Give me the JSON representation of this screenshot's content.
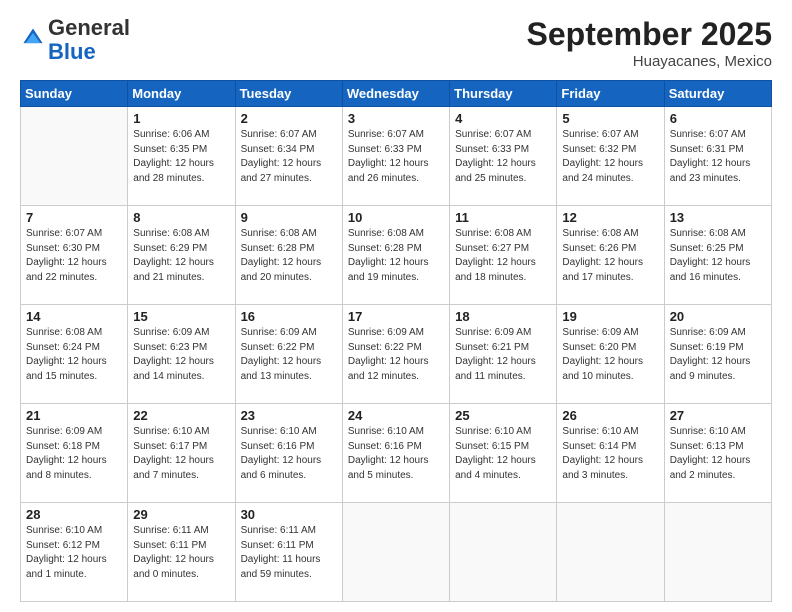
{
  "logo": {
    "line1": "General",
    "line2": "Blue"
  },
  "header": {
    "title": "September 2025",
    "subtitle": "Huayacanes, Mexico"
  },
  "weekdays": [
    "Sunday",
    "Monday",
    "Tuesday",
    "Wednesday",
    "Thursday",
    "Friday",
    "Saturday"
  ],
  "weeks": [
    [
      {
        "day": "",
        "info": ""
      },
      {
        "day": "1",
        "info": "Sunrise: 6:06 AM\nSunset: 6:35 PM\nDaylight: 12 hours\nand 28 minutes."
      },
      {
        "day": "2",
        "info": "Sunrise: 6:07 AM\nSunset: 6:34 PM\nDaylight: 12 hours\nand 27 minutes."
      },
      {
        "day": "3",
        "info": "Sunrise: 6:07 AM\nSunset: 6:33 PM\nDaylight: 12 hours\nand 26 minutes."
      },
      {
        "day": "4",
        "info": "Sunrise: 6:07 AM\nSunset: 6:33 PM\nDaylight: 12 hours\nand 25 minutes."
      },
      {
        "day": "5",
        "info": "Sunrise: 6:07 AM\nSunset: 6:32 PM\nDaylight: 12 hours\nand 24 minutes."
      },
      {
        "day": "6",
        "info": "Sunrise: 6:07 AM\nSunset: 6:31 PM\nDaylight: 12 hours\nand 23 minutes."
      }
    ],
    [
      {
        "day": "7",
        "info": "Sunrise: 6:07 AM\nSunset: 6:30 PM\nDaylight: 12 hours\nand 22 minutes."
      },
      {
        "day": "8",
        "info": "Sunrise: 6:08 AM\nSunset: 6:29 PM\nDaylight: 12 hours\nand 21 minutes."
      },
      {
        "day": "9",
        "info": "Sunrise: 6:08 AM\nSunset: 6:28 PM\nDaylight: 12 hours\nand 20 minutes."
      },
      {
        "day": "10",
        "info": "Sunrise: 6:08 AM\nSunset: 6:28 PM\nDaylight: 12 hours\nand 19 minutes."
      },
      {
        "day": "11",
        "info": "Sunrise: 6:08 AM\nSunset: 6:27 PM\nDaylight: 12 hours\nand 18 minutes."
      },
      {
        "day": "12",
        "info": "Sunrise: 6:08 AM\nSunset: 6:26 PM\nDaylight: 12 hours\nand 17 minutes."
      },
      {
        "day": "13",
        "info": "Sunrise: 6:08 AM\nSunset: 6:25 PM\nDaylight: 12 hours\nand 16 minutes."
      }
    ],
    [
      {
        "day": "14",
        "info": "Sunrise: 6:08 AM\nSunset: 6:24 PM\nDaylight: 12 hours\nand 15 minutes."
      },
      {
        "day": "15",
        "info": "Sunrise: 6:09 AM\nSunset: 6:23 PM\nDaylight: 12 hours\nand 14 minutes."
      },
      {
        "day": "16",
        "info": "Sunrise: 6:09 AM\nSunset: 6:22 PM\nDaylight: 12 hours\nand 13 minutes."
      },
      {
        "day": "17",
        "info": "Sunrise: 6:09 AM\nSunset: 6:22 PM\nDaylight: 12 hours\nand 12 minutes."
      },
      {
        "day": "18",
        "info": "Sunrise: 6:09 AM\nSunset: 6:21 PM\nDaylight: 12 hours\nand 11 minutes."
      },
      {
        "day": "19",
        "info": "Sunrise: 6:09 AM\nSunset: 6:20 PM\nDaylight: 12 hours\nand 10 minutes."
      },
      {
        "day": "20",
        "info": "Sunrise: 6:09 AM\nSunset: 6:19 PM\nDaylight: 12 hours\nand 9 minutes."
      }
    ],
    [
      {
        "day": "21",
        "info": "Sunrise: 6:09 AM\nSunset: 6:18 PM\nDaylight: 12 hours\nand 8 minutes."
      },
      {
        "day": "22",
        "info": "Sunrise: 6:10 AM\nSunset: 6:17 PM\nDaylight: 12 hours\nand 7 minutes."
      },
      {
        "day": "23",
        "info": "Sunrise: 6:10 AM\nSunset: 6:16 PM\nDaylight: 12 hours\nand 6 minutes."
      },
      {
        "day": "24",
        "info": "Sunrise: 6:10 AM\nSunset: 6:16 PM\nDaylight: 12 hours\nand 5 minutes."
      },
      {
        "day": "25",
        "info": "Sunrise: 6:10 AM\nSunset: 6:15 PM\nDaylight: 12 hours\nand 4 minutes."
      },
      {
        "day": "26",
        "info": "Sunrise: 6:10 AM\nSunset: 6:14 PM\nDaylight: 12 hours\nand 3 minutes."
      },
      {
        "day": "27",
        "info": "Sunrise: 6:10 AM\nSunset: 6:13 PM\nDaylight: 12 hours\nand 2 minutes."
      }
    ],
    [
      {
        "day": "28",
        "info": "Sunrise: 6:10 AM\nSunset: 6:12 PM\nDaylight: 12 hours\nand 1 minute."
      },
      {
        "day": "29",
        "info": "Sunrise: 6:11 AM\nSunset: 6:11 PM\nDaylight: 12 hours\nand 0 minutes."
      },
      {
        "day": "30",
        "info": "Sunrise: 6:11 AM\nSunset: 6:11 PM\nDaylight: 11 hours\nand 59 minutes."
      },
      {
        "day": "",
        "info": ""
      },
      {
        "day": "",
        "info": ""
      },
      {
        "day": "",
        "info": ""
      },
      {
        "day": "",
        "info": ""
      }
    ]
  ]
}
